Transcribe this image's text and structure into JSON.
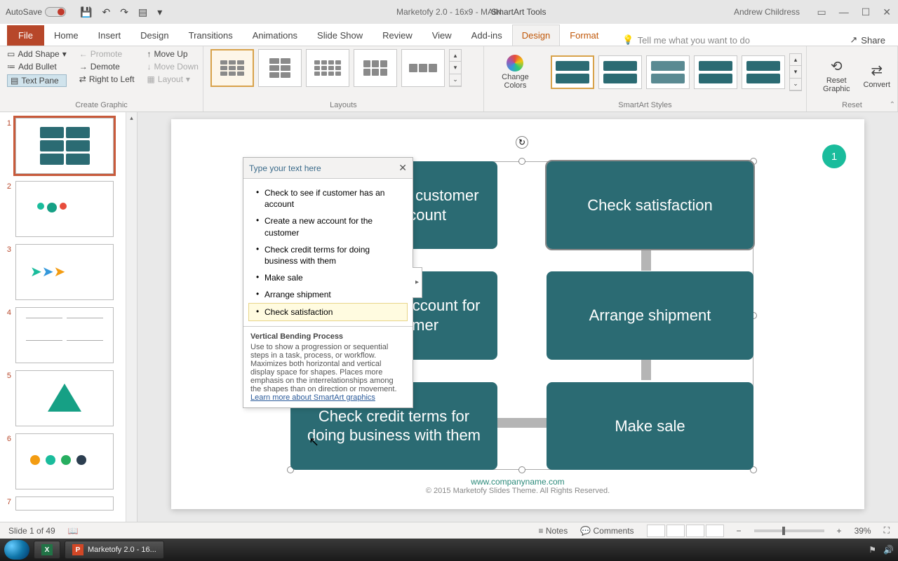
{
  "titlebar": {
    "autosave_label": "AutoSave",
    "doc_title": "Marketofy 2.0 - 16x9 - MAIN",
    "smartart_tools": "SmartArt Tools",
    "user": "Andrew Childress"
  },
  "tabs": {
    "file": "File",
    "home": "Home",
    "insert": "Insert",
    "design": "Design",
    "transitions": "Transitions",
    "animations": "Animations",
    "slideshow": "Slide Show",
    "review": "Review",
    "view": "View",
    "addins": "Add-ins",
    "sa_design": "Design",
    "sa_format": "Format",
    "tell_me": "Tell me what you want to do",
    "share": "Share"
  },
  "ribbon": {
    "create_graphic": {
      "add_shape": "Add Shape",
      "add_bullet": "Add Bullet",
      "text_pane": "Text Pane",
      "promote": "Promote",
      "demote": "Demote",
      "rtl": "Right to Left",
      "move_up": "Move Up",
      "move_down": "Move Down",
      "layout": "Layout",
      "group_label": "Create Graphic"
    },
    "layouts_label": "Layouts",
    "change_colors": "Change Colors",
    "styles_label": "SmartArt Styles",
    "reset": {
      "reset_graphic": "Reset Graphic",
      "convert": "Convert",
      "group_label": "Reset"
    }
  },
  "text_pane": {
    "header": "Type your text here",
    "items": [
      "Check to see if customer has an account",
      "Create a new account for the customer",
      "Check credit terms for doing business with them",
      "Make sale",
      "Arrange shipment",
      "Check satisfaction"
    ],
    "desc_title": "Vertical Bending Process",
    "desc_body": "Use to show a progression or sequential steps in a task, process, or workflow. Maximizes both horizontal and vertical display space for shapes. Places more emphasis on the interrelationships among the shapes than on direction or movement.",
    "learn_more": "Learn more about SmartArt graphics"
  },
  "smartart": {
    "box1": "Check to see if customer has an account",
    "box2": "Check satisfaction",
    "box3": "Create a new account for the customer",
    "box4": "Arrange shipment",
    "box5": "Check credit terms for doing business with them",
    "box6": "Make sale"
  },
  "slide": {
    "badge": "1",
    "url": "www.companyname.com",
    "copyright": "© 2015 Marketofy Slides Theme. All Rights Reserved."
  },
  "status": {
    "slide_info": "Slide 1 of 49",
    "notes": "Notes",
    "comments": "Comments",
    "zoom": "39%"
  },
  "taskbar": {
    "pp_label": "Marketofy 2.0 - 16..."
  },
  "thumbs": [
    "1",
    "2",
    "3",
    "4",
    "5",
    "6",
    "7"
  ]
}
